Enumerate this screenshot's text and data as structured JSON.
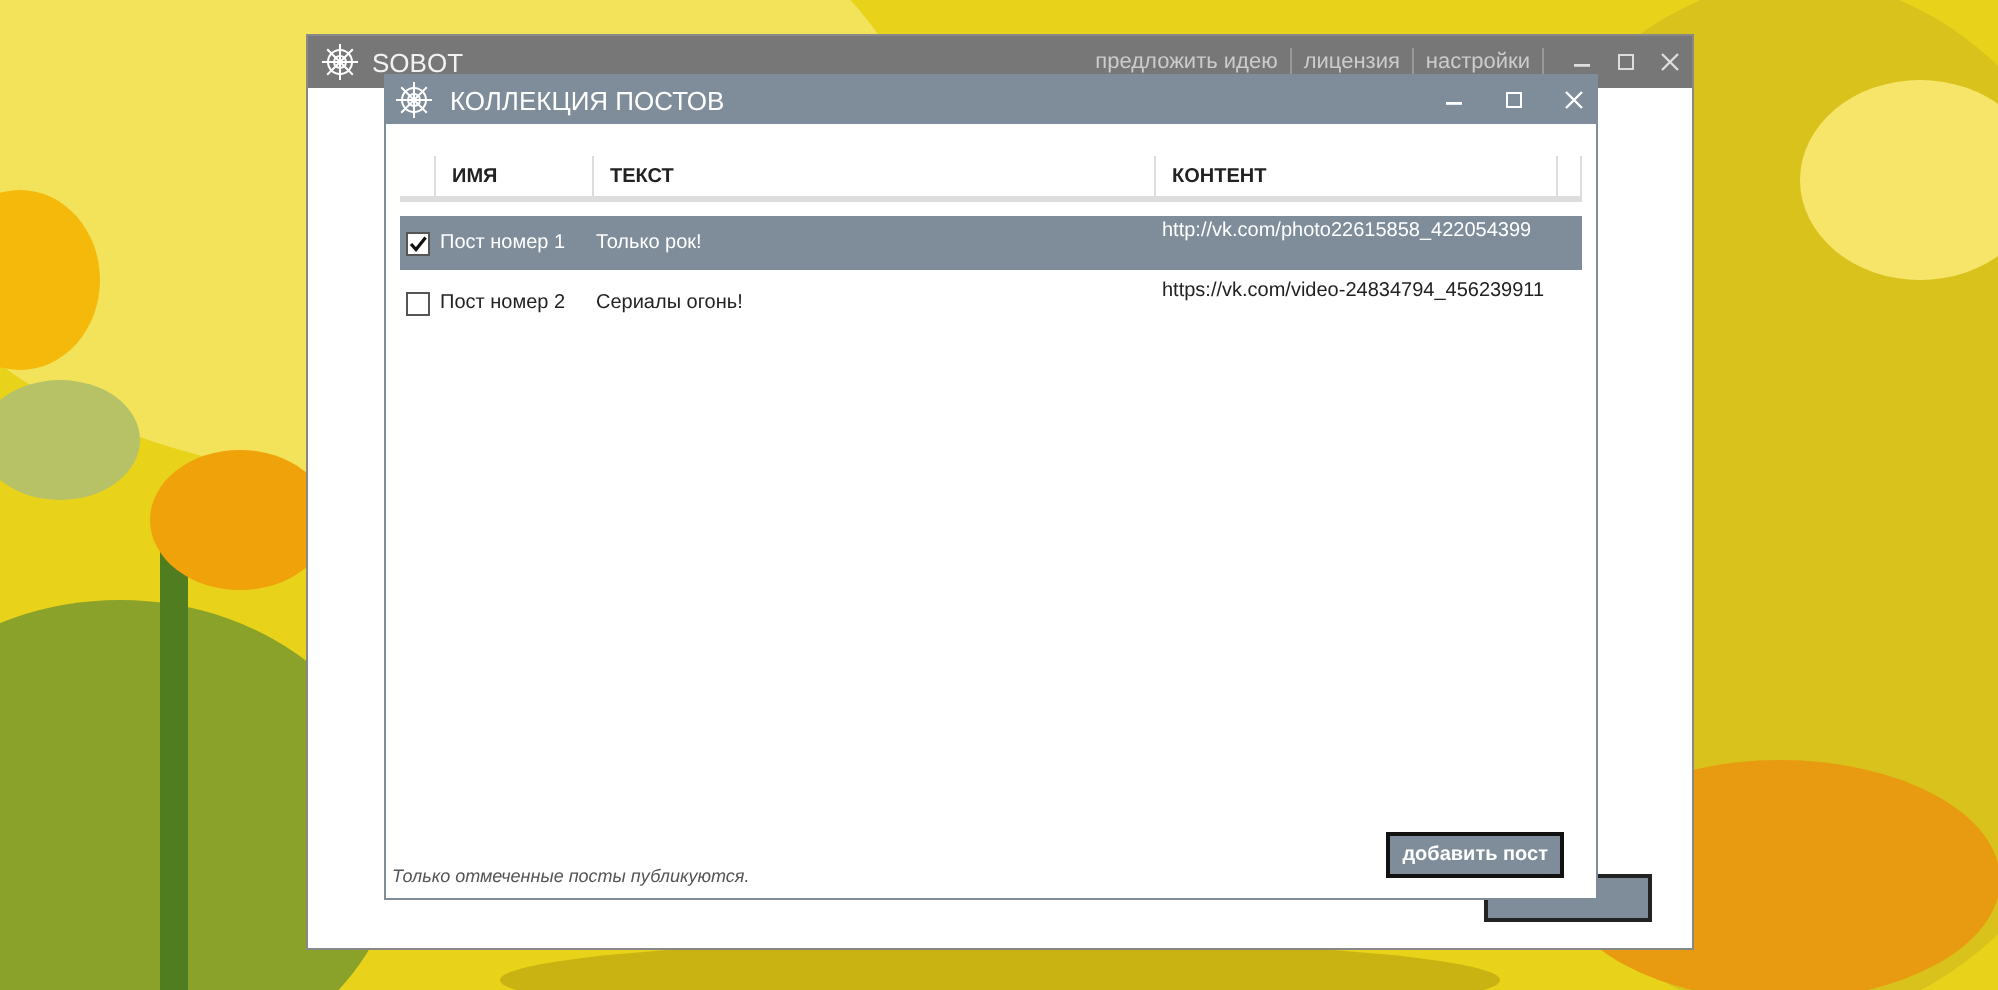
{
  "main_window": {
    "title": "SOBOT",
    "menu": [
      "предложить идею",
      "лицензия",
      "настройки"
    ]
  },
  "dialog": {
    "title": "КОЛЛЕКЦИЯ ПОСТОВ",
    "table": {
      "columns": [
        "ИМЯ",
        "ТЕКСТ",
        "КОНТЕНТ"
      ],
      "rows": [
        {
          "checked": true,
          "selected": true,
          "name": "Пост номер 1",
          "text": "Только рок!",
          "content": "http://vk.com/photo22615858_422054399"
        },
        {
          "checked": false,
          "selected": false,
          "name": "Пост номер 2",
          "text": "Сериалы огонь!",
          "content": "https://vk.com/video-24834794_456239911"
        }
      ]
    },
    "note": "Только отмеченные посты публикуются.",
    "add_button": "добавить пост"
  }
}
